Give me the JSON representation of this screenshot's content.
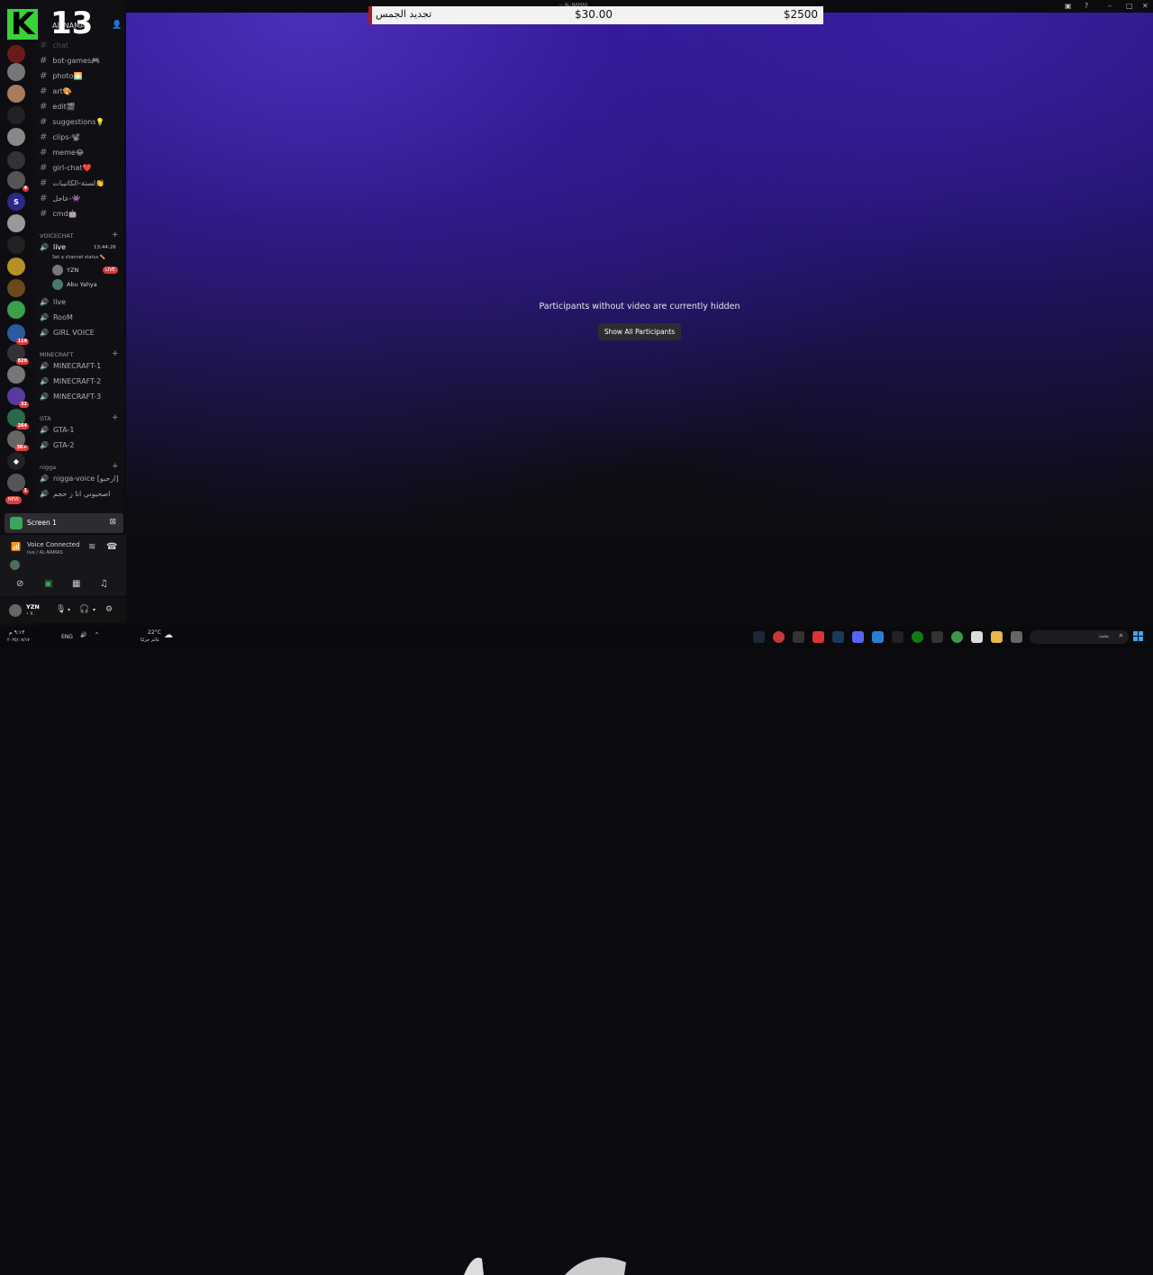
{
  "logo": {
    "letter": "K",
    "number": "13"
  },
  "titlebar": {
    "app_name": "— AL-NAMAS"
  },
  "donation": {
    "label": "تجديد الجمس",
    "current": "$30.00",
    "goal": "$2500"
  },
  "server": {
    "name": "AL-NAMAS"
  },
  "channels": {
    "text": [
      "chat",
      "bot-games🎮",
      "photo🌅",
      "art🎨",
      "edit🎬",
      "suggestions💡",
      "clips-📽️",
      "meme😂",
      "girl-chat❤️",
      "لستة-الكاتيبات👏",
      "عاجل-👾",
      "cmd🤖"
    ],
    "voicechat_category": "VOICECHAT",
    "live_channel": "live",
    "live_timer": "13:44:26",
    "status_hint": "Set a channel status ✏️",
    "users": [
      {
        "name": "YZN",
        "tag": "LIVE"
      },
      {
        "name": "Abu Yahya",
        "tag": ""
      }
    ],
    "voice": [
      "live",
      "RooM",
      "GIRL VOICE"
    ],
    "minecraft_category": "MINECRAFT",
    "minecraft": [
      "MINECRAFT-1",
      "MINECRAFT-2",
      "MINECRAFT-3"
    ],
    "gta_category": "GTA",
    "gta": [
      "GTA-1",
      "GTA-2"
    ],
    "nigga_category": "nigga",
    "nigga": [
      "nigga-voice [ارحبو]",
      "اصحيوني انا ز حجم"
    ]
  },
  "rail": {
    "badges": [
      "4",
      "119",
      "829",
      "32",
      "264",
      "3K+",
      "1"
    ],
    "new_label": "NEW"
  },
  "screen_share": {
    "title": "Screen 1"
  },
  "voice_connection": {
    "status": "Voice Connected",
    "location": "live / AL-NAMAS"
  },
  "user_panel": {
    "name": "YZN",
    "status": "• K."
  },
  "stage": {
    "message": "Participants without video are currently hidden",
    "button": "Show All Participants"
  },
  "taskbar": {
    "time": "٩:١٣ م",
    "date": "٢٠٢٥/٠٨/١٧",
    "lang": "ENG",
    "weather_temp": "22°C",
    "weather_desc": "غائم جزئيًا",
    "search_placeholder": "بحث"
  },
  "colors": {
    "accent_green": "#3ba55c",
    "live_red": "#d83c3e",
    "blurple": "#4b2fb8",
    "donation_bar": "#b21a1a"
  }
}
